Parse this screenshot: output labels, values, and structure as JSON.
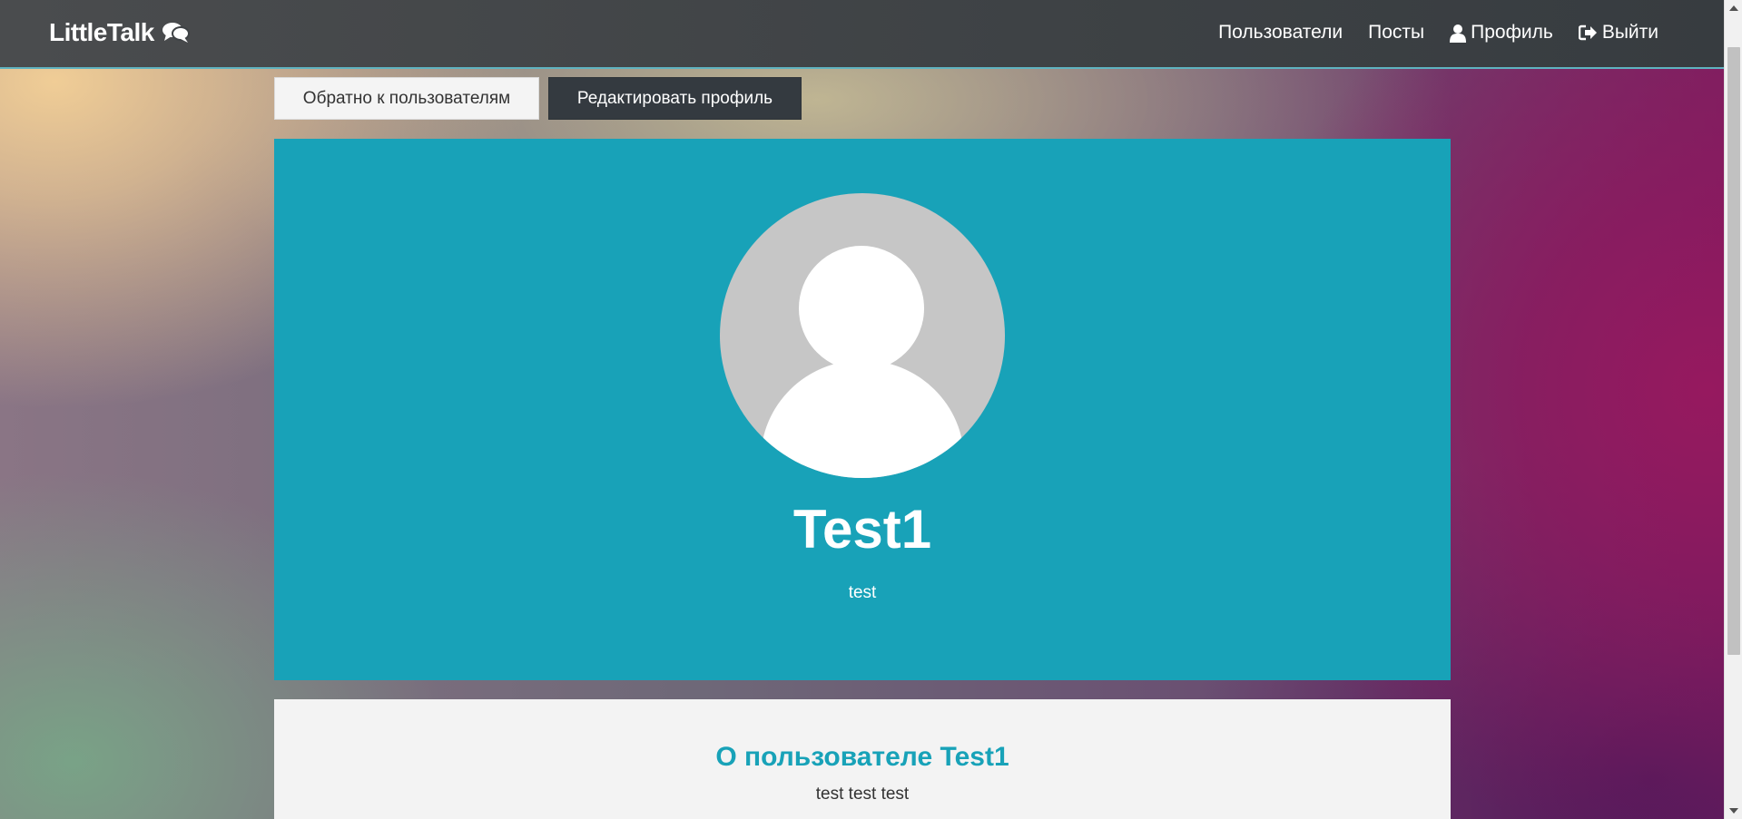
{
  "navbar": {
    "brand": "LittleTalk",
    "brand_icon": "comments-icon",
    "links": [
      {
        "label": "Пользователи",
        "icon": ""
      },
      {
        "label": "Посты",
        "icon": ""
      },
      {
        "label": "Профиль",
        "icon": "user-icon"
      },
      {
        "label": "Выйти",
        "icon": "sign-out-icon"
      }
    ]
  },
  "actions": {
    "back_label": "Обратно к пользователям",
    "edit_label": "Редактировать профиль"
  },
  "profile": {
    "username": "Test1",
    "status": "test",
    "avatar_icon": "default-avatar-icon"
  },
  "about": {
    "title": "О пользователе Test1",
    "text": "test test test"
  },
  "colors": {
    "accent": "#18a2b8",
    "navbar": "#3e4245",
    "edit_button": "#343a40"
  }
}
